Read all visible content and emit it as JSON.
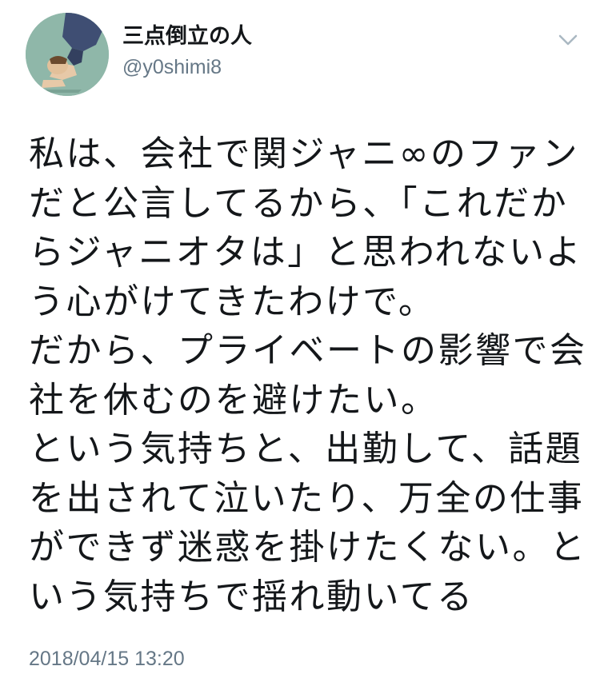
{
  "user": {
    "display_name": "三点倒立の人",
    "handle": "@y0shimi8"
  },
  "menu": {
    "icon": "chevron-down-icon"
  },
  "tweet": {
    "lines": [
      "私は、会社で関ジャニ∞のファン",
      "だと公言してるから、「これだか",
      "らジャニオタは」と思われないよ",
      "う心がけてきたわけで。",
      "だから、プライベートの影響で会",
      "社を休むのを避けたい。",
      "という気持ちと、出勤して、話題",
      "を出されて泣いたり、万全の仕事",
      "ができず迷惑を掛けたくない。と",
      "いう気持ちで揺れ動いてる"
    ],
    "timestamp": "2018/04/15 13:20"
  },
  "colors": {
    "text": "#14171a",
    "secondary": "#657786",
    "avatar_bg": "#8fb7a9"
  }
}
